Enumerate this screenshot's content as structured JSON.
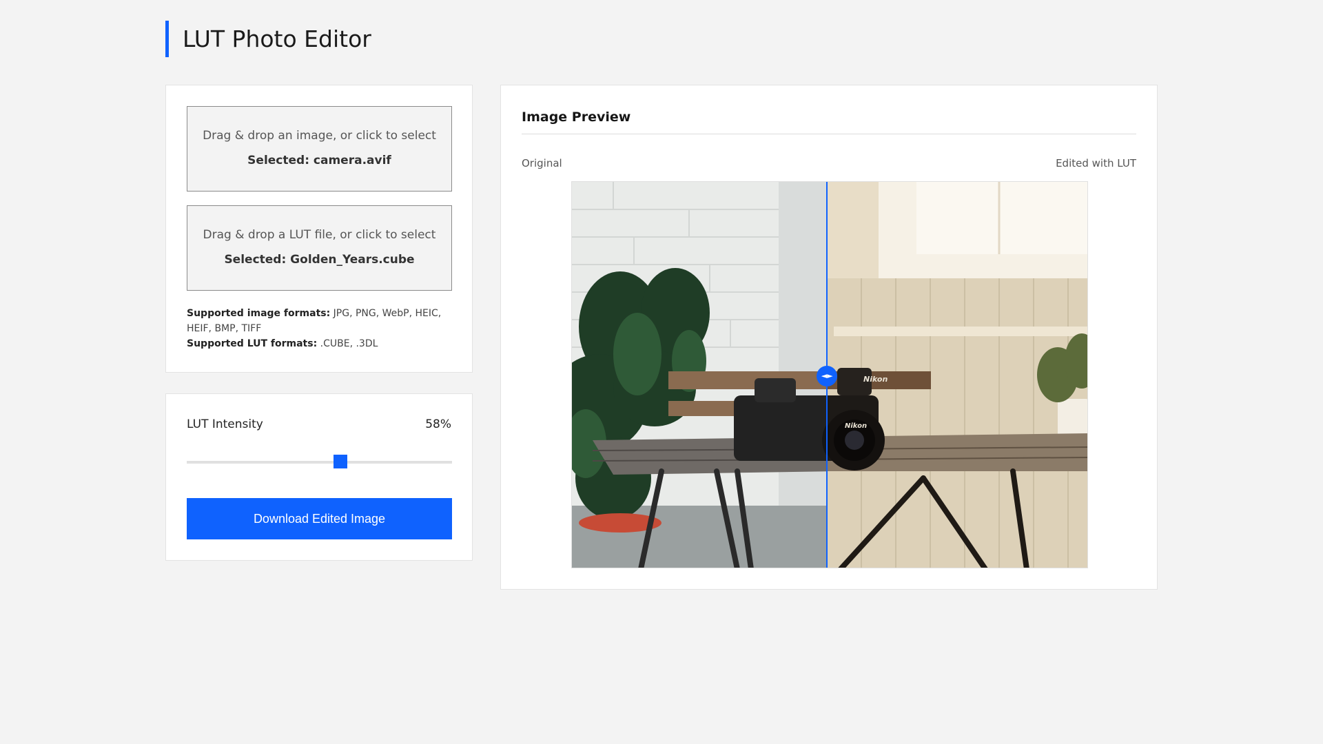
{
  "app": {
    "title": "LUT Photo Editor",
    "accent_color": "#0f62fe"
  },
  "upload": {
    "image_drop": {
      "hint": "Drag & drop an image, or click to select",
      "selected": "Selected: camera.avif"
    },
    "lut_drop": {
      "hint": "Drag & drop a LUT file, or click to select",
      "selected": "Selected: Golden_Years.cube"
    },
    "formats": {
      "image_label": "Supported image formats:",
      "image_value": "JPG, PNG, WebP, HEIC, HEIF, BMP, TIFF",
      "lut_label": "Supported LUT formats:",
      "lut_value": ".CUBE, .3DL"
    }
  },
  "intensity": {
    "label": "LUT Intensity",
    "value_text": "58%",
    "value_fraction": 0.58
  },
  "download": {
    "label": "Download Edited Image"
  },
  "preview": {
    "title": "Image Preview",
    "original_label": "Original",
    "edited_label": "Edited with LUT",
    "split_fraction": 0.495,
    "handle_glyph": "◄►",
    "camera_brand": "Nikon"
  },
  "icons": {
    "compare_handle": "split-arrows-icon"
  }
}
